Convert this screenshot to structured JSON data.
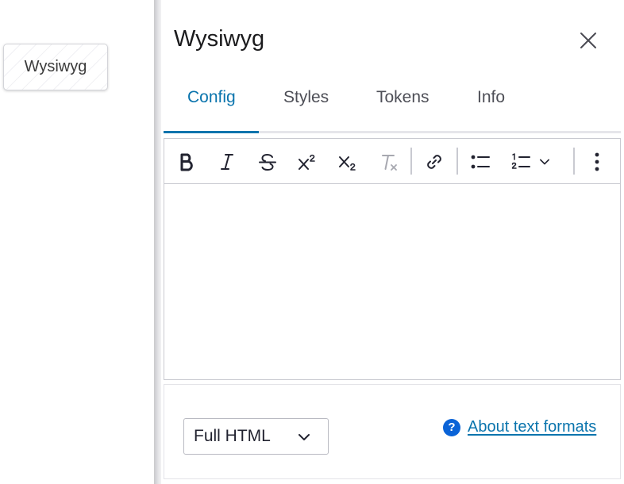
{
  "canvas": {
    "component_label": "Wysiwyg"
  },
  "panel": {
    "title": "Wysiwyg",
    "close_icon": "close-icon",
    "tabs": [
      {
        "label": "Config",
        "active": true
      },
      {
        "label": "Styles",
        "active": false
      },
      {
        "label": "Tokens",
        "active": false
      },
      {
        "label": "Info",
        "active": false
      }
    ]
  },
  "editor": {
    "toolbar": [
      "bold-icon",
      "italic-icon",
      "strikethrough-icon",
      "superscript-icon",
      "subscript-icon",
      "remove-format-icon",
      "link-icon",
      "bulleted-list-icon",
      "numbered-list-icon",
      "chevron-down-icon",
      "more-vertical-icon"
    ],
    "content": ""
  },
  "format": {
    "selected": "Full HTML",
    "help_link": "About text formats"
  },
  "colors": {
    "accent": "#0a74ad",
    "help_icon": "#0a63d7"
  }
}
